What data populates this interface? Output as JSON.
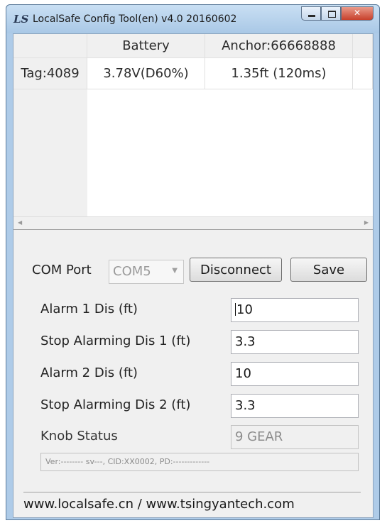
{
  "window": {
    "title": "LocalSafe Config Tool(en) v4.0 20160602",
    "icon": "LS"
  },
  "grid": {
    "headers": [
      "",
      "Battery",
      "Anchor:66668888"
    ],
    "rows": [
      {
        "tag": "Tag:4089",
        "battery": "3.78V(D60%)",
        "anchor": "1.35ft (120ms)"
      }
    ]
  },
  "com": {
    "label": "COM Port",
    "selected": "COM5",
    "disconnect_label": "Disconnect",
    "save_label": "Save"
  },
  "settings": {
    "alarm1_label": "Alarm 1 Dis (ft)",
    "alarm1_value": "10",
    "stop1_label": "Stop Alarming Dis 1 (ft)",
    "stop1_value": "3.3",
    "alarm2_label": "Alarm 2 Dis (ft)",
    "alarm2_value": "10",
    "stop2_label": "Stop Alarming Dis 2 (ft)",
    "stop2_value": "3.3",
    "knob_label": "Knob Status",
    "knob_value": "9 GEAR"
  },
  "version_text": "Ver:-------- sv---, CID:XX0002, PD:-------------",
  "footer": "www.localsafe.cn / www.tsingyantech.com"
}
